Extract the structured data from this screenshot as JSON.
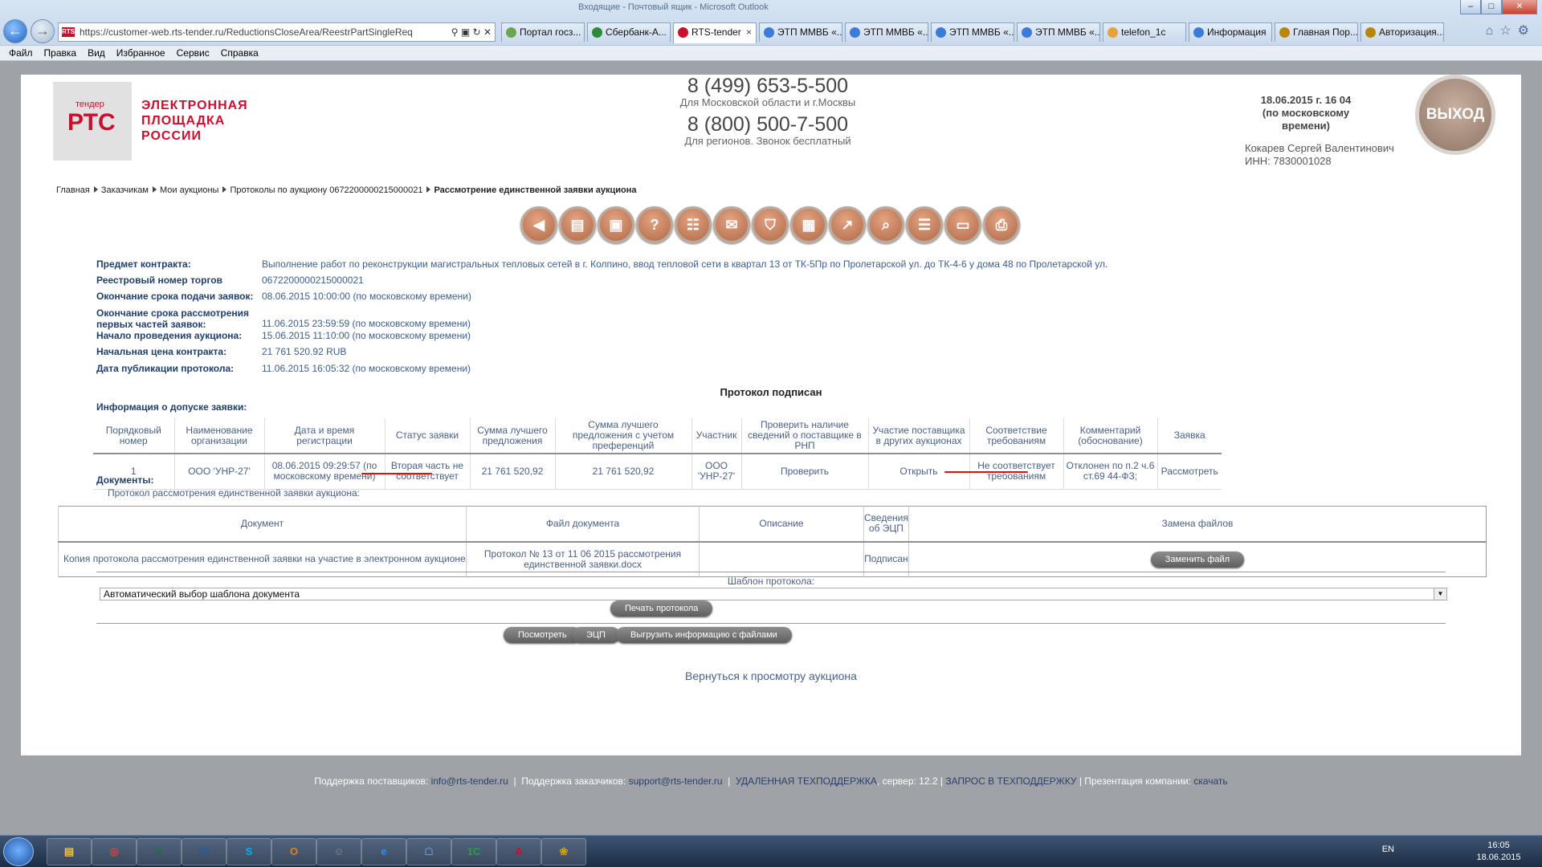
{
  "browser": {
    "window_title": "Входящие - Почтовый ящик - Microsoft Outlook",
    "url": "https://customer-web.rts-tender.ru/ReductionsCloseArea/ReestrPartSingleReq",
    "favicon": "RTS",
    "tabs": [
      {
        "label": "Портал госз...",
        "color": "#6aa84f"
      },
      {
        "label": "Сбербанк-А...",
        "color": "#2e8b3a"
      },
      {
        "label": "RTS-tender",
        "color": "#c8102e",
        "active": true
      },
      {
        "label": "ЭТП ММВБ «...",
        "color": "#3d7bd9"
      },
      {
        "label": "ЭТП ММВБ «...",
        "color": "#3d7bd9"
      },
      {
        "label": "ЭТП ММВБ «...",
        "color": "#3d7bd9"
      },
      {
        "label": "ЭТП ММВБ «...",
        "color": "#3d7bd9"
      },
      {
        "label": "telefon_1c",
        "color": "#e6a23c"
      },
      {
        "label": "Информация",
        "color": "#3d7bd9"
      },
      {
        "label": "Главная Пор...",
        "color": "#b8860b"
      },
      {
        "label": "Авторизация...",
        "color": "#b8860b"
      }
    ],
    "menu": [
      "Файл",
      "Правка",
      "Вид",
      "Избранное",
      "Сервис",
      "Справка"
    ]
  },
  "header": {
    "logo_small": "тендер",
    "logo_big": "РТС",
    "logo_text": [
      "ЭЛЕКТРОННАЯ",
      "ПЛОЩАДКА",
      "РОССИИ"
    ],
    "phone1": "8 (499) 653-5-500",
    "phone1_note": "Для Московской области и г.Москвы",
    "phone2": "8 (800) 500-7-500",
    "phone2_note": "Для регионов. Звонок бесплатный",
    "datetime": "18.06.2015 г. 16 04",
    "datetime_note": "(по московскому времени)",
    "user_name": "Кокарев Сергей Валентинович",
    "user_inn": "ИНН: 7830001028",
    "exit_label": "ВЫХОД"
  },
  "breadcrumb": [
    "Главная",
    "Заказчикам",
    "Мои аукционы",
    "Протоколы по аукциону 0672200000215000021",
    "Рассмотрение единственной заявки аукциона"
  ],
  "toolbar_icons": [
    "back-icon",
    "briefcase-icon",
    "bag-icon",
    "help-icon",
    "document-icon",
    "mail-icon",
    "cart-icon",
    "table-icon",
    "chart-icon",
    "search-icon",
    "list-icon",
    "monitor-icon",
    "printer-icon"
  ],
  "details": [
    {
      "label": "Предмет контракта:",
      "value": "Выполнение работ по реконструкции магистральных тепловых сетей в г. Колпино, ввод тепловой сети в квартал 13 от ТК-5Пр по Пролетарской ул. до ТК-4-6 у дома 48 по Пролетарской ул."
    },
    {
      "label": "Реестровый номер торгов",
      "value": "0672200000215000021"
    },
    {
      "label": "Окончание срока подачи заявок:",
      "value": "08.06.2015 10:00:00 (по московскому времени)"
    },
    {
      "label": "Окончание срока рассмотрения первых частей заявок:",
      "value": "11.06.2015 23:59:59 (по московскому времени)"
    },
    {
      "label": "Начало проведения аукциона:",
      "value": "15.06.2015 11:10:00 (по московскому времени)"
    },
    {
      "label": "Начальная цена контракта:",
      "value": "21 761 520.92 RUB"
    },
    {
      "label": "Дата публикации протокола:",
      "value": "11.06.2015 16:05:32 (по московскому времени)"
    }
  ],
  "protocol_signed": "Протокол подписан",
  "admission_title": "Информация о допуске заявки:",
  "admission_table": {
    "headers": [
      "Порядковый номер",
      "Наименование организации",
      "Дата и время регистрации",
      "Статус заявки",
      "Сумма лучшего предложения",
      "Сумма лучшего предложения с учетом преференций",
      "Участник",
      "Проверить наличие сведений о поставщике в РНП",
      "Участие поставщика в других аукционах",
      "Соответствие требованиям",
      "Комментарий (обоснование)",
      "Заявка"
    ],
    "row": [
      "1",
      "ООО 'УНР-27'",
      "08.06.2015 09:29:57 (по московскому времени)",
      "Вторая часть не соответствует",
      "21 761 520,92",
      "21 761 520,92",
      "ООО 'УНР-27'",
      "Проверить",
      "Открыть",
      "Не соответствует требованиям",
      "Отклонен по п.2 ч.6 ст.69 44-ФЗ;",
      "Рассмотреть"
    ]
  },
  "documents_title": "Документы:",
  "protocol_caption": "Протокол рассмотрения единственной заявки аукциона:",
  "doc_table": {
    "headers": [
      "Документ",
      "Файл документа",
      "Описание",
      "Сведения об ЭЦП",
      "Замена файлов"
    ],
    "row": {
      "document": "Копия протокола рассмотрения единственной заявки на участие в электронном аукционе",
      "file": "Протокол № 13 от 11 06 2015 рассмотрения единственной заявки.docx",
      "description": "",
      "signature": "Подписан",
      "replace_button": "Заменить файл"
    }
  },
  "template": {
    "label": "Шаблон протокола:",
    "selected": "Автоматический выбор шаблона документа",
    "print_button": "Печать протокола"
  },
  "actions": [
    "Посмотреть",
    "ЭЦП",
    "Выгрузить информацию с файлами"
  ],
  "back_link": "Вернуться к просмотру аукциона",
  "footer": {
    "supplier_support_label": "Поддержка поставщиков:",
    "supplier_support_email": "info@rts-tender.ru",
    "customer_support_label": "Поддержка заказчиков:",
    "customer_support_email": "support@rts-tender.ru",
    "remote": "УДАЛЕННАЯ ТЕХПОДДЕРЖКА",
    "server": ", сервер: 12.2 |",
    "request": "ЗАПРОС В ТЕХПОДДЕРЖКУ",
    "presentation_label": "| Презентация компании:",
    "presentation_link": "скачать"
  },
  "taskbar": {
    "apps": [
      "explorer-icon",
      "chrome-icon",
      "excel-icon",
      "word-icon",
      "skype-icon",
      "outlook-icon",
      "app-icon",
      "ie-icon",
      "network-icon",
      "1c-icon",
      "pdf-icon",
      "paint-icon"
    ],
    "lang": "EN",
    "time": "16:05",
    "date": "18.06.2015"
  },
  "colors": {
    "brand": "#c8102e",
    "label": "#1f3f6a",
    "value": "#3d5e8a",
    "underline": "#dd1111"
  }
}
